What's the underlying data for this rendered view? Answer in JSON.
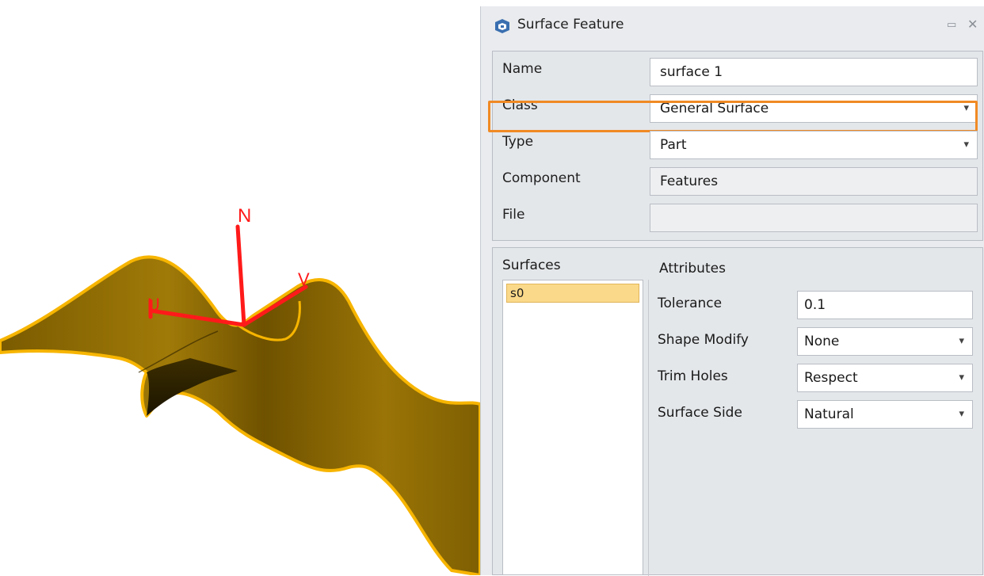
{
  "viewport": {
    "axes": {
      "n_label": "N",
      "u_label": "U",
      "v_label": "V",
      "axis_color": "#ff1a1a"
    },
    "surface_color": "#9a7406",
    "edge_color": "#f7b500"
  },
  "panel": {
    "title": "Surface Feature",
    "icons": {
      "app": "surface-feature-icon",
      "pin": "pin-icon",
      "close": "close-icon"
    },
    "properties": {
      "name_label": "Name",
      "name_value": "surface 1",
      "class_label": "Class",
      "class_value": "General Surface",
      "type_label": "Type",
      "type_value": "Part",
      "component_label": "Component",
      "component_value": "Features",
      "file_label": "File",
      "file_value": ""
    },
    "highlight_color": "#f08a24",
    "surfaces": {
      "label": "Surfaces",
      "items": [
        "s0"
      ]
    },
    "attributes": {
      "label": "Attributes",
      "tolerance_label": "Tolerance",
      "tolerance_value": "0.1",
      "shape_modify_label": "Shape Modify",
      "shape_modify_value": "None",
      "trim_holes_label": "Trim Holes",
      "trim_holes_value": "Respect",
      "surface_side_label": "Surface Side",
      "surface_side_value": "Natural"
    }
  }
}
